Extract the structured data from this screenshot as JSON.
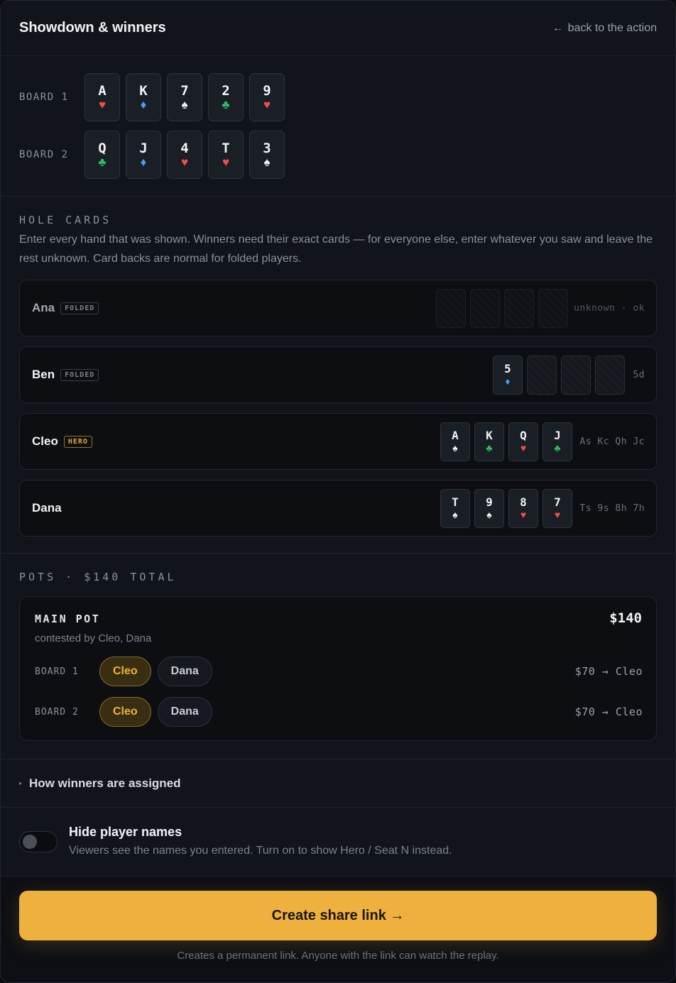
{
  "header": {
    "title": "Showdown & winners",
    "back_arrow": "←",
    "back_label": "back to the action"
  },
  "boards": [
    {
      "label": "BOARD 1",
      "cards": [
        {
          "rank": "A",
          "suit": "♥",
          "color": "#ef4f4f"
        },
        {
          "rank": "K",
          "suit": "♦",
          "color": "#4a9df0"
        },
        {
          "rank": "7",
          "suit": "♠",
          "color": "#f2f3f5"
        },
        {
          "rank": "2",
          "suit": "♣",
          "color": "#2fbf5f"
        },
        {
          "rank": "9",
          "suit": "♥",
          "color": "#ef4f4f"
        }
      ]
    },
    {
      "label": "BOARD 2",
      "cards": [
        {
          "rank": "Q",
          "suit": "♣",
          "color": "#2fbf5f"
        },
        {
          "rank": "J",
          "suit": "♦",
          "color": "#4a9df0"
        },
        {
          "rank": "4",
          "suit": "♥",
          "color": "#ef4f4f"
        },
        {
          "rank": "T",
          "suit": "♥",
          "color": "#ef4f4f"
        },
        {
          "rank": "3",
          "suit": "♠",
          "color": "#f2f3f5"
        }
      ]
    }
  ],
  "hole": {
    "title": "HOLE CARDS",
    "hint": "Enter every hand that was shown. Winners need their exact cards — for everyone else, enter whatever you saw and leave the rest unknown. Card backs are normal for folded players.",
    "players": [
      {
        "name": "Ana",
        "tag": "FOLDED",
        "summary": "unknown · ok"
      },
      {
        "name": "Ben",
        "tag": "FOLDED",
        "summary": "5d",
        "card1": {
          "rank": "5",
          "suit": "♦"
        }
      },
      {
        "name": "Cleo",
        "tag": "HERO",
        "summary": "As Kc Qh Jc",
        "cards": [
          {
            "rank": "A",
            "suit": "♠"
          },
          {
            "rank": "K",
            "suit": "♣"
          },
          {
            "rank": "Q",
            "suit": "♥"
          },
          {
            "rank": "J",
            "suit": "♣"
          }
        ]
      },
      {
        "name": "Dana",
        "summary": "Ts 9s 8h 7h",
        "cards": [
          {
            "rank": "T",
            "suit": "♠"
          },
          {
            "rank": "9",
            "suit": "♠"
          },
          {
            "rank": "8",
            "suit": "♥"
          },
          {
            "rank": "7",
            "suit": "♥"
          }
        ]
      }
    ]
  },
  "pots": {
    "title": "POTS · $140 TOTAL",
    "main": {
      "title": "MAIN POT",
      "amount": "$140",
      "contested": "contested by Cleo, Dana",
      "rows": [
        {
          "label": "BOARD 1",
          "chip1": "Cleo",
          "chip2": "Dana",
          "award": "$70 → Cleo"
        },
        {
          "label": "BOARD 2",
          "chip1": "Cleo",
          "chip2": "Dana",
          "award": "$70 → Cleo"
        }
      ]
    }
  },
  "how": {
    "marker": "▸",
    "label": "How winners are assigned"
  },
  "toggle": {
    "title": "Hide player names",
    "desc": "Viewers see the names you entered. Turn on to show Hero / Seat N instead."
  },
  "cta": {
    "label": "Create share link →",
    "foot": "Creates a permanent link. Anyone with the link can watch the replay."
  },
  "colors": {
    "accent": "#eeb13d",
    "heart": "#ef4f4f",
    "diamond": "#4a9df0",
    "club": "#2fbf5f",
    "spade": "#f2f3f5"
  }
}
